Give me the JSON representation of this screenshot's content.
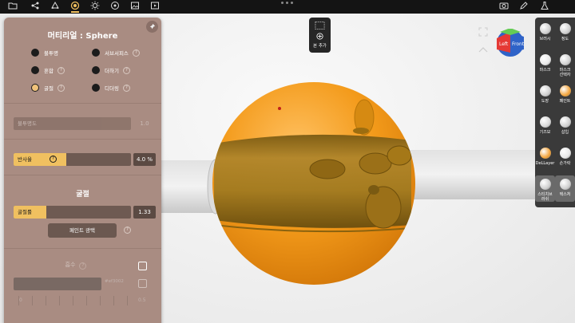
{
  "topbar": {
    "left_icons": [
      "folder-icon",
      "share-icon",
      "scene-icon",
      "material-icon",
      "sun-icon",
      "camera-settings-icon",
      "image-icon",
      "video-icon"
    ],
    "right_icons": [
      "screenshot-icon",
      "pen-icon",
      "flask-icon"
    ]
  },
  "panel": {
    "title": "머티리얼 : Sphere",
    "modes": [
      {
        "label": "불투명",
        "selected": false,
        "help": false
      },
      {
        "label": "서브서피스",
        "selected": false,
        "help": true
      },
      {
        "label": "혼합",
        "selected": false,
        "help": true
      },
      {
        "label": "더하기",
        "selected": false,
        "help": true
      },
      {
        "label": "굴절",
        "selected": true,
        "help": true
      },
      {
        "label": "디더링",
        "selected": false,
        "help": true
      }
    ],
    "help_glyph": "?",
    "opacity": {
      "label": "불투명도",
      "value": "1.0"
    },
    "reflectance": {
      "label": "반사율",
      "value": "4.0 %",
      "fraction": 0.45
    },
    "refraction_title": "굴절",
    "refraction_slider": {
      "label": "굴절률",
      "value": "1.33",
      "fraction": 0.28
    },
    "paint_gloss_button": "페인트 광택",
    "absorption_label": "흡수",
    "absorption_color": "#ef3002",
    "dist_start": "0",
    "dist_value": "0.5"
  },
  "bone_button": {
    "label": "본 추가"
  },
  "gizmo": {
    "left": "Left",
    "front": "Front"
  },
  "toolbar": {
    "tools": [
      {
        "label": "브러시",
        "icon": "brush-sphere-icon"
      },
      {
        "label": "정도",
        "icon": "smooth-sphere-icon"
      },
      {
        "label": "마스크",
        "icon": "mask-icon"
      },
      {
        "label": "마스크\n선택자",
        "icon": "mask-selector-icon"
      },
      {
        "label": "도장",
        "icon": "stamp-icon"
      },
      {
        "label": "페인트",
        "icon": "paint-icon"
      },
      {
        "label": "기즈모",
        "icon": "gizmo-icon"
      },
      {
        "label": "삽입",
        "icon": "insert-icon"
      },
      {
        "label": "DeLLayer",
        "icon": "layer-icon"
      },
      {
        "label": "손가락",
        "icon": "finger-icon"
      },
      {
        "label": "스티치브\n러쉬",
        "icon": "stitch-brush-icon"
      },
      {
        "label": "텍스처",
        "icon": "texture-icon"
      }
    ]
  },
  "colors": {
    "sphere": "#f39a1a",
    "cylinder": "#b0852a",
    "panel_bg": "#a98c82",
    "accent": "#f0c060"
  }
}
